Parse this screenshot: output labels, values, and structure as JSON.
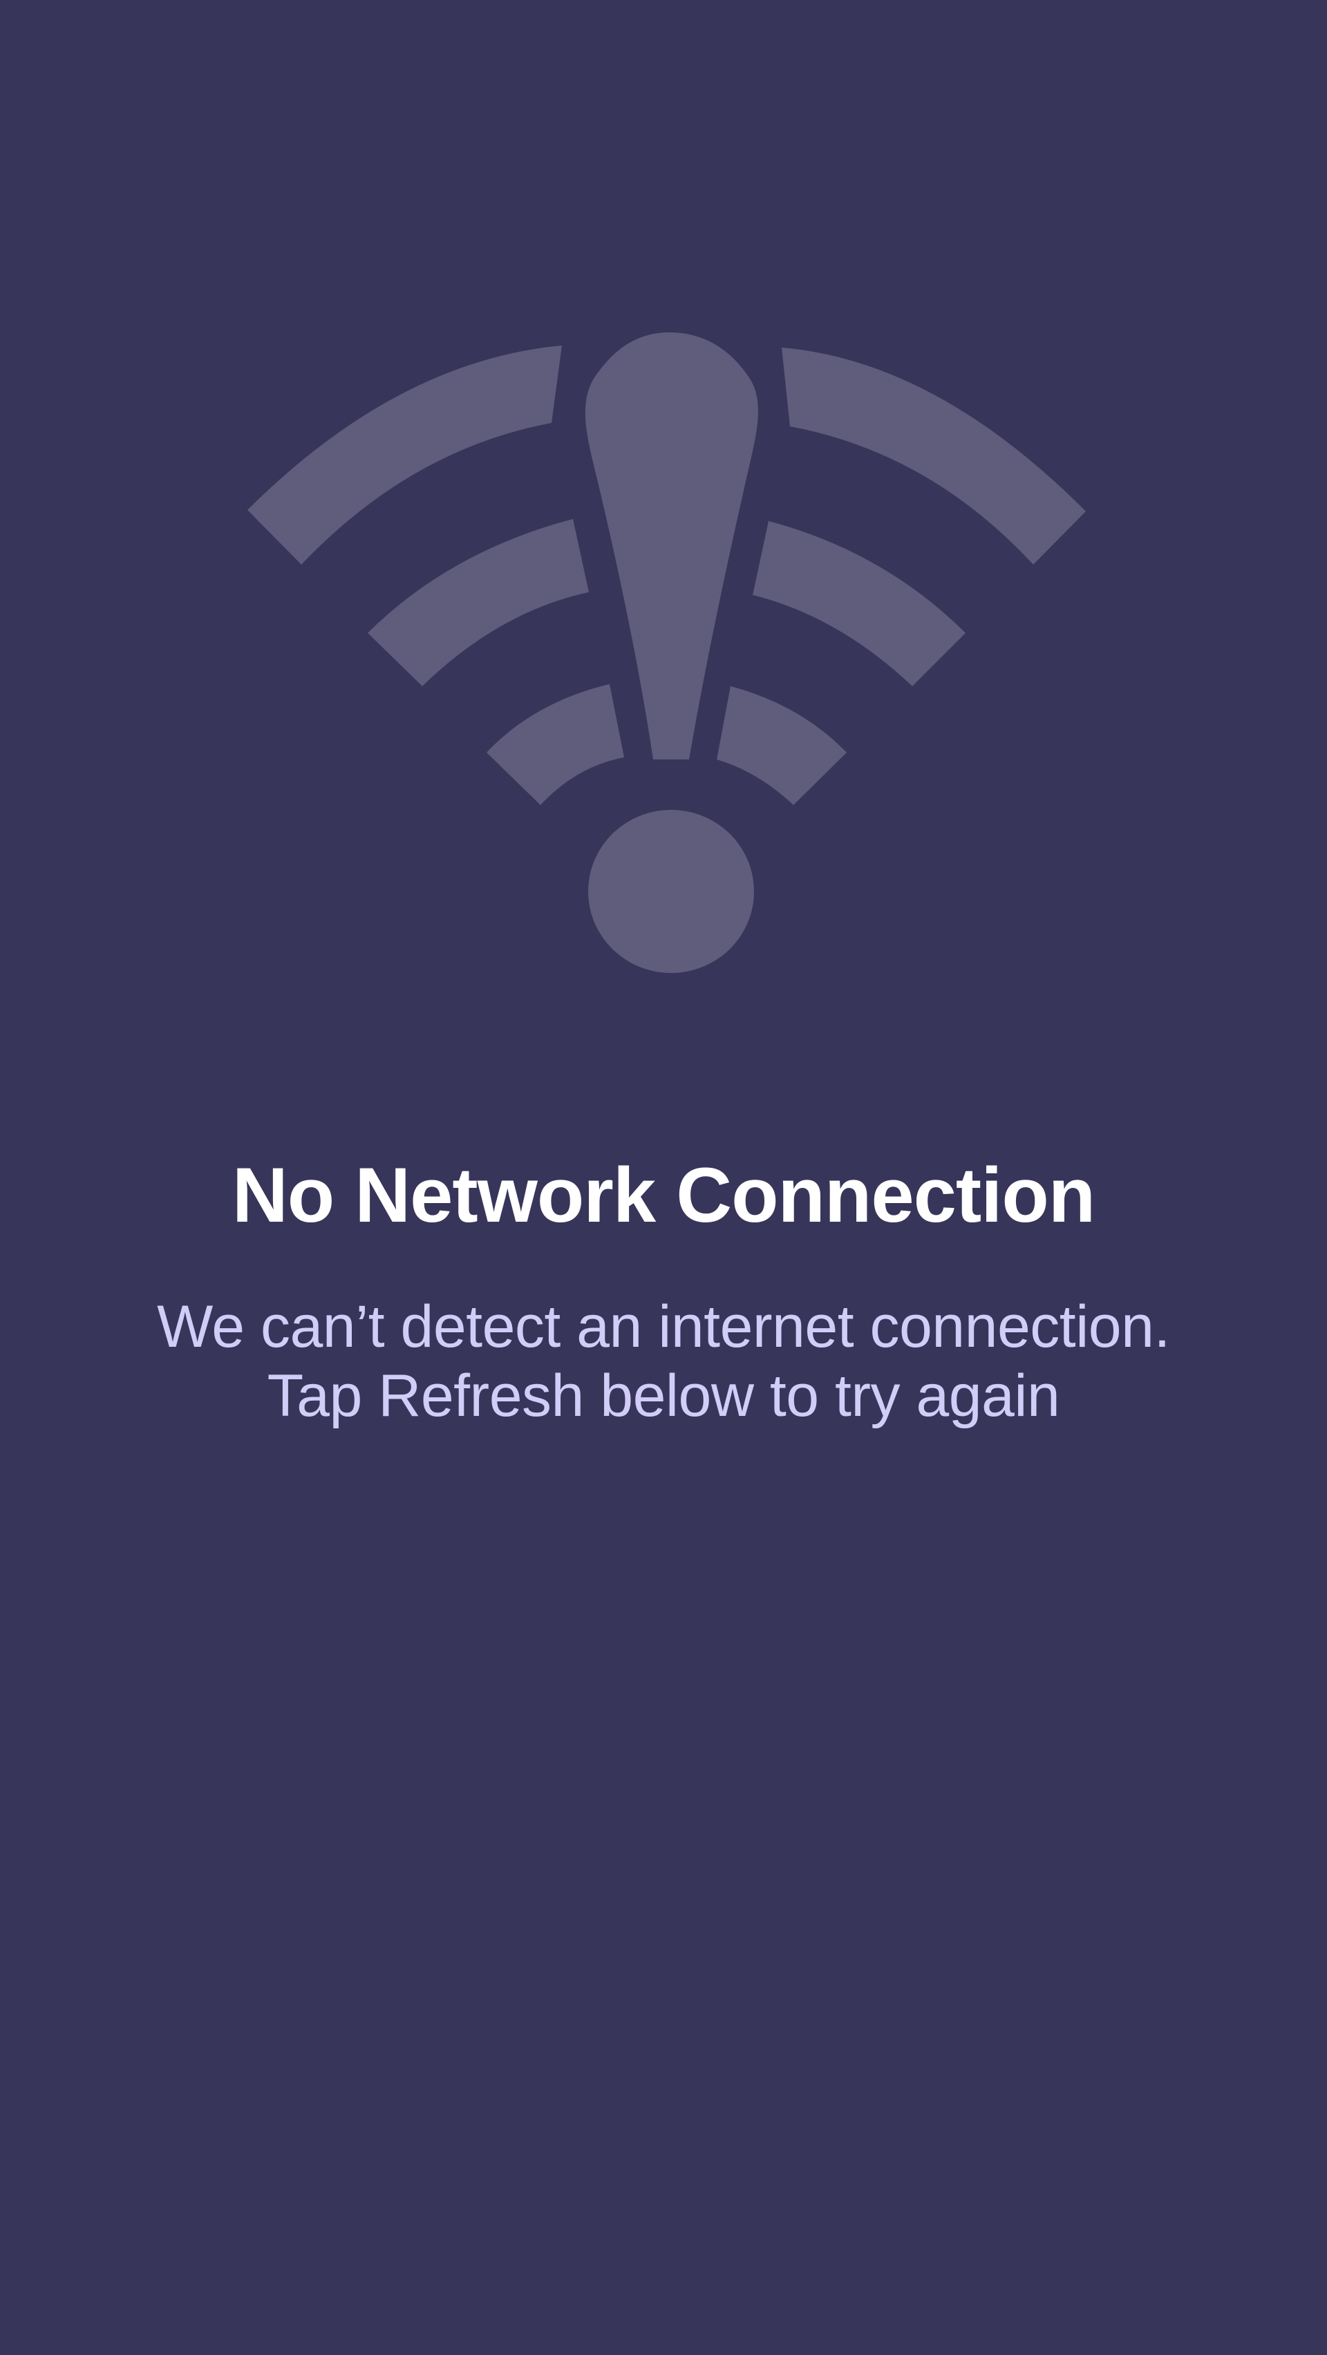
{
  "screen": {
    "title": "No Network Connection",
    "message_lines": [
      "We can’t detect an internet connection.",
      "Tap Refresh below to try again"
    ],
    "icon": "wifi-alert-icon"
  },
  "colors": {
    "background": "#38355a",
    "icon": "#5f5c7c",
    "title": "#ffffff",
    "message": "#d2cdf8"
  }
}
